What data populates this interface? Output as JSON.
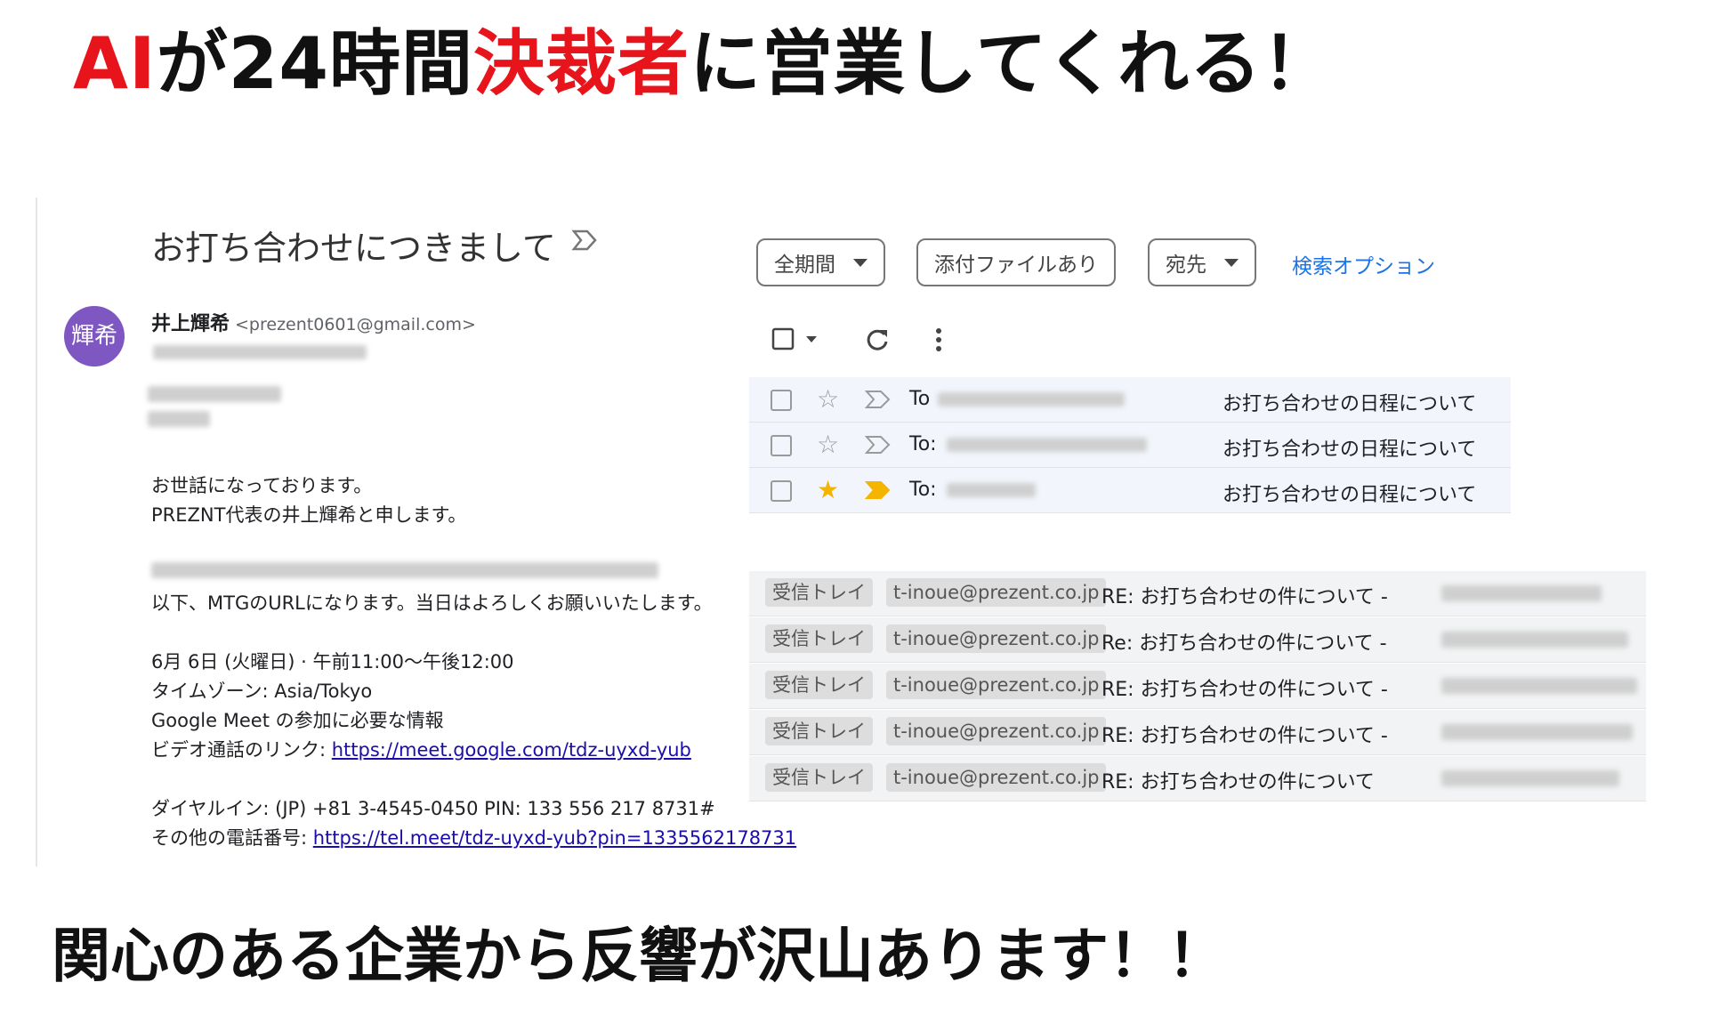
{
  "headline": {
    "part1": "AI",
    "part2": "が24時間",
    "part3": "決裁者",
    "part4": "に営業してくれる！"
  },
  "email": {
    "subject": "お打ち合わせにつきまして",
    "avatar_text": "輝希",
    "sender_name": "井上輝希",
    "sender_email": "<prezent0601@gmail.com>",
    "greeting": "お世話になっております。",
    "intro": "PREZNT代表の井上輝希と申します。",
    "url_line": "以下、MTGのURLになります。当日はよろしくお願いいたします。",
    "datetime": "6月 6日 (火曜日) · 午前11:00～午後12:00",
    "timezone": "タイムゾーン: Asia/Tokyo",
    "meet_info": "Google Meet の参加に必要な情報",
    "video_label": "ビデオ通話のリンク: ",
    "video_link": "https://meet.google.com/tdz-uyxd-yub",
    "dial_in": "ダイヤルイン: (JP) +81 3-4545-0450 PIN: 133 556 217 8731#",
    "other_label": "その他の電話番号: ",
    "other_link": "https://tel.meet/tdz-uyxd-yub?pin=1335562178731"
  },
  "filters": {
    "period": "全期間",
    "attachment": "添付ファイルあり",
    "recipient": "宛先",
    "search_options": "検索オプション"
  },
  "sent_rows": [
    {
      "to": "To",
      "subject": "お打ち合わせの日程について",
      "starred": false
    },
    {
      "to": "To:",
      "subject": "お打ち合わせの日程について",
      "starred": false
    },
    {
      "to": "To:",
      "subject": "お打ち合わせの日程について",
      "starred": true
    }
  ],
  "inbox_rows": [
    {
      "label1": "受信トレイ",
      "label2": "t-inoue@prezent.co.jp",
      "subject": "RE: お打ち合わせの件について -"
    },
    {
      "label1": "受信トレイ",
      "label2": "t-inoue@prezent.co.jp",
      "subject": "Re: お打ち合わせの件について -"
    },
    {
      "label1": "受信トレイ",
      "label2": "t-inoue@prezent.co.jp",
      "subject": "RE: お打ち合わせの件について -"
    },
    {
      "label1": "受信トレイ",
      "label2": "t-inoue@prezent.co.jp",
      "subject": "RE: お打ち合わせの件について -"
    },
    {
      "label1": "受信トレイ",
      "label2": "t-inoue@prezent.co.jp",
      "subject": "RE: お打ち合わせの件について"
    }
  ],
  "footer": "関心のある企業から反響が沢山あります！！",
  "colors": {
    "accent_red": "#e8141c",
    "avatar": "#7e57c2",
    "link": "#1a0dab",
    "gmail_blue": "#1a73e8",
    "star": "#f4b400"
  },
  "icons": [
    "important-marker-icon",
    "checkbox-icon",
    "dropdown-caret-icon",
    "refresh-icon",
    "more-vert-icon",
    "star-icon"
  ]
}
